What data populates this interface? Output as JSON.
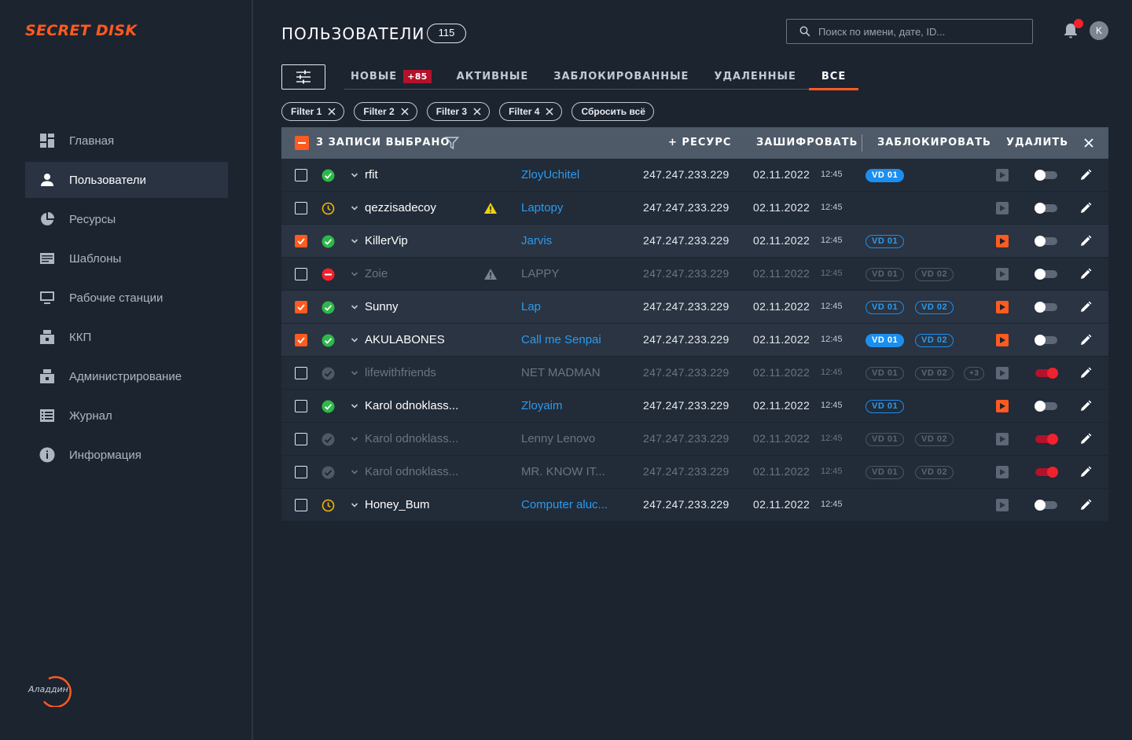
{
  "app": {
    "logo": "SECRET DISK",
    "vendor": "Аладдин"
  },
  "sidebar": {
    "items": [
      {
        "label": "Главная",
        "icon": "dashboard-icon",
        "active": false
      },
      {
        "label": "Пользователи",
        "icon": "user-icon",
        "active": true
      },
      {
        "label": "Ресурсы",
        "icon": "pie-chart-icon",
        "active": false
      },
      {
        "label": "Шаблоны",
        "icon": "template-icon",
        "active": false
      },
      {
        "label": "Рабочие станции",
        "icon": "monitor-icon",
        "active": false
      },
      {
        "label": "ККП",
        "icon": "printer-icon",
        "active": false
      },
      {
        "label": "Администрирование",
        "icon": "printer-icon",
        "active": false
      },
      {
        "label": "Журнал",
        "icon": "journal-icon",
        "active": false
      },
      {
        "label": "Информация",
        "icon": "info-icon",
        "active": false
      }
    ]
  },
  "header": {
    "title": "ПОЛЬЗОВАТЕЛИ",
    "count": "115",
    "search_placeholder": "Поиск по имени, дате, ID...",
    "avatar_initial": "K"
  },
  "tabs": [
    {
      "label": "НОВЫЕ",
      "badge": "+85",
      "active": false
    },
    {
      "label": "АКТИВНЫЕ",
      "active": false
    },
    {
      "label": "ЗАБЛОКИРОВАННЫЕ",
      "active": false
    },
    {
      "label": "УДАЛЕННЫЕ",
      "active": false
    },
    {
      "label": "ВСЕ",
      "active": true
    }
  ],
  "chips": [
    "Filter 1",
    "Filter 2",
    "Filter 3",
    "Filter 4"
  ],
  "reset_label": "Сбросить всё",
  "table_header": {
    "selected": "3 ЗАПИСИ ВЫБРАНО",
    "add_resource": "+ РЕСУРС",
    "encrypt": "ЗАШИФРОВАТЬ",
    "block": "ЗАБЛОКИРОВАТЬ",
    "delete": "УДАЛИТЬ"
  },
  "colors": {
    "accent": "#ff5a1f",
    "link": "#2a9bf0",
    "ok": "#2fb84a",
    "pending": "#f2b705",
    "blocked": "#f0222e"
  },
  "rows": [
    {
      "checked": false,
      "status": "ok",
      "name": "rfit",
      "warn": "",
      "resource": "ZloyUchitel",
      "ip": "247.247.233.229",
      "date": "02.11.2022",
      "time": "12:45",
      "vds": [
        {
          "label": "VD 01",
          "style": "filled"
        }
      ],
      "more": "",
      "play": false,
      "toggle": false,
      "dim": false
    },
    {
      "checked": false,
      "status": "pending",
      "name": "qezzisadecoy",
      "warn": "yellow",
      "resource": "Laptopy",
      "ip": "247.247.233.229",
      "date": "02.11.2022",
      "time": "12:45",
      "vds": [],
      "more": "",
      "play": false,
      "toggle": false,
      "dim": false
    },
    {
      "checked": true,
      "status": "ok",
      "name": "KillerVip",
      "warn": "",
      "resource": "Jarvis",
      "ip": "247.247.233.229",
      "date": "02.11.2022",
      "time": "12:45",
      "vds": [
        {
          "label": "VD 01",
          "style": "outline"
        }
      ],
      "more": "",
      "play": true,
      "toggle": false,
      "dim": false
    },
    {
      "checked": false,
      "status": "blocked",
      "name": "Zoie",
      "warn": "grey",
      "resource": "LAPPY",
      "ip": "247.247.233.229",
      "date": "02.11.2022",
      "time": "12:45",
      "vds": [
        {
          "label": "VD 01",
          "style": "grey"
        },
        {
          "label": "VD 02",
          "style": "grey"
        }
      ],
      "more": "",
      "play": false,
      "toggle": false,
      "dim": true
    },
    {
      "checked": true,
      "status": "ok",
      "name": "Sunny",
      "warn": "",
      "resource": "Lap",
      "ip": "247.247.233.229",
      "date": "02.11.2022",
      "time": "12:45",
      "vds": [
        {
          "label": "VD 01",
          "style": "outline"
        },
        {
          "label": "VD 02",
          "style": "outline"
        }
      ],
      "more": "",
      "play": true,
      "toggle": false,
      "dim": false
    },
    {
      "checked": true,
      "status": "ok",
      "name": "AKULABONES",
      "warn": "",
      "resource": "Call me Senpai",
      "ip": "247.247.233.229",
      "date": "02.11.2022",
      "time": "12:45",
      "vds": [
        {
          "label": "VD 01",
          "style": "filled"
        },
        {
          "label": "VD 02",
          "style": "outline"
        }
      ],
      "more": "",
      "play": true,
      "toggle": false,
      "dim": false
    },
    {
      "checked": false,
      "status": "deleted",
      "name": "lifewithfriends",
      "warn": "",
      "resource": "NET MADMAN",
      "ip": "247.247.233.229",
      "date": "02.11.2022",
      "time": "12:45",
      "vds": [
        {
          "label": "VD 01",
          "style": "grey"
        },
        {
          "label": "VD 02",
          "style": "grey"
        }
      ],
      "more": "+3",
      "play": false,
      "toggle": true,
      "dim": true
    },
    {
      "checked": false,
      "status": "ok",
      "name": "Karol odnoklass...",
      "warn": "",
      "resource": "Zloyaim",
      "ip": "247.247.233.229",
      "date": "02.11.2022",
      "time": "12:45",
      "vds": [
        {
          "label": "VD 01",
          "style": "outline"
        }
      ],
      "more": "",
      "play": true,
      "toggle": false,
      "dim": false
    },
    {
      "checked": false,
      "status": "deleted",
      "name": "Karol odnoklass...",
      "warn": "",
      "resource": "Lenny Lenovo",
      "ip": "247.247.233.229",
      "date": "02.11.2022",
      "time": "12:45",
      "vds": [
        {
          "label": "VD 01",
          "style": "grey"
        },
        {
          "label": "VD 02",
          "style": "grey"
        }
      ],
      "more": "",
      "play": false,
      "toggle": true,
      "dim": true
    },
    {
      "checked": false,
      "status": "deleted",
      "name": "Karol odnoklass...",
      "warn": "",
      "resource": "MR. KNOW IT...",
      "ip": "247.247.233.229",
      "date": "02.11.2022",
      "time": "12:45",
      "vds": [
        {
          "label": "VD 01",
          "style": "grey"
        },
        {
          "label": "VD 02",
          "style": "grey"
        }
      ],
      "more": "",
      "play": false,
      "toggle": true,
      "dim": true
    },
    {
      "checked": false,
      "status": "pending",
      "name": "Honey_Bum",
      "warn": "",
      "resource": "Computer aluc...",
      "ip": "247.247.233.229",
      "date": "02.11.2022",
      "time": "12:45",
      "vds": [],
      "more": "",
      "play": false,
      "toggle": false,
      "dim": false
    }
  ]
}
